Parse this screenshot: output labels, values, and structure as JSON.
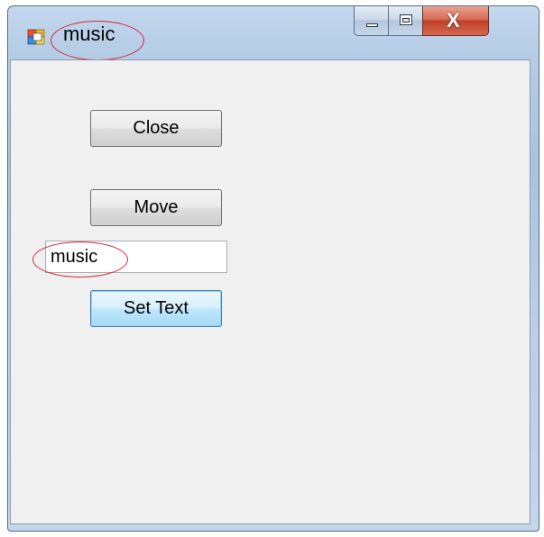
{
  "window": {
    "title": "music",
    "app_icon": "windows-forms-app-icon",
    "caption_buttons": {
      "minimize_icon": "minimize-icon",
      "maximize_icon": "maximize-icon",
      "close_icon": "close-icon",
      "close_glyph": "X"
    }
  },
  "form": {
    "close_button_label": "Close",
    "move_button_label": "Move",
    "text_input_value": "music",
    "set_text_button_label": "Set Text"
  },
  "annotation_color": "#d9243a"
}
